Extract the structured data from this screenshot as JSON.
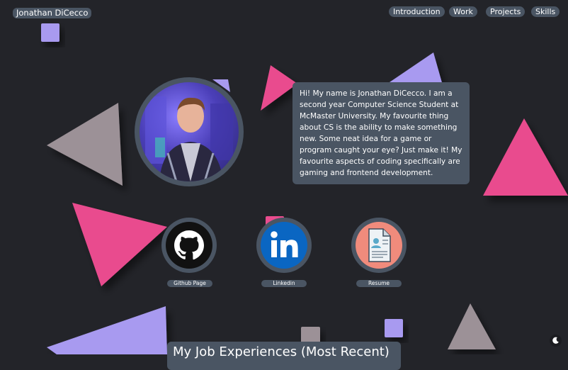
{
  "header": {
    "brand": "Jonathan DiCecco",
    "nav": [
      "Introduction",
      "Work",
      "Projects",
      "Skills"
    ]
  },
  "bio": {
    "text": "Hi! My name is Jonathan DiCecco. I am a second year Computer Science Student at McMaster University. My favourite thing about CS is the ability to make something new. Some neat idea for a game or program caught your eye? Just make it! My favourite aspects of coding specifically are gaming and frontend development."
  },
  "social": [
    {
      "label": "Github Page",
      "icon": "github-icon"
    },
    {
      "label": "Linkedin",
      "icon": "linkedin-icon"
    },
    {
      "label": "Resume",
      "icon": "resume-icon"
    }
  ],
  "section": {
    "title": "My Job Experiences (Most Recent)"
  },
  "colors": {
    "background": "#232429",
    "panel": "#4a5563",
    "pink": "#e94c8e",
    "purple": "#a89af0",
    "gray": "#9c9197"
  }
}
